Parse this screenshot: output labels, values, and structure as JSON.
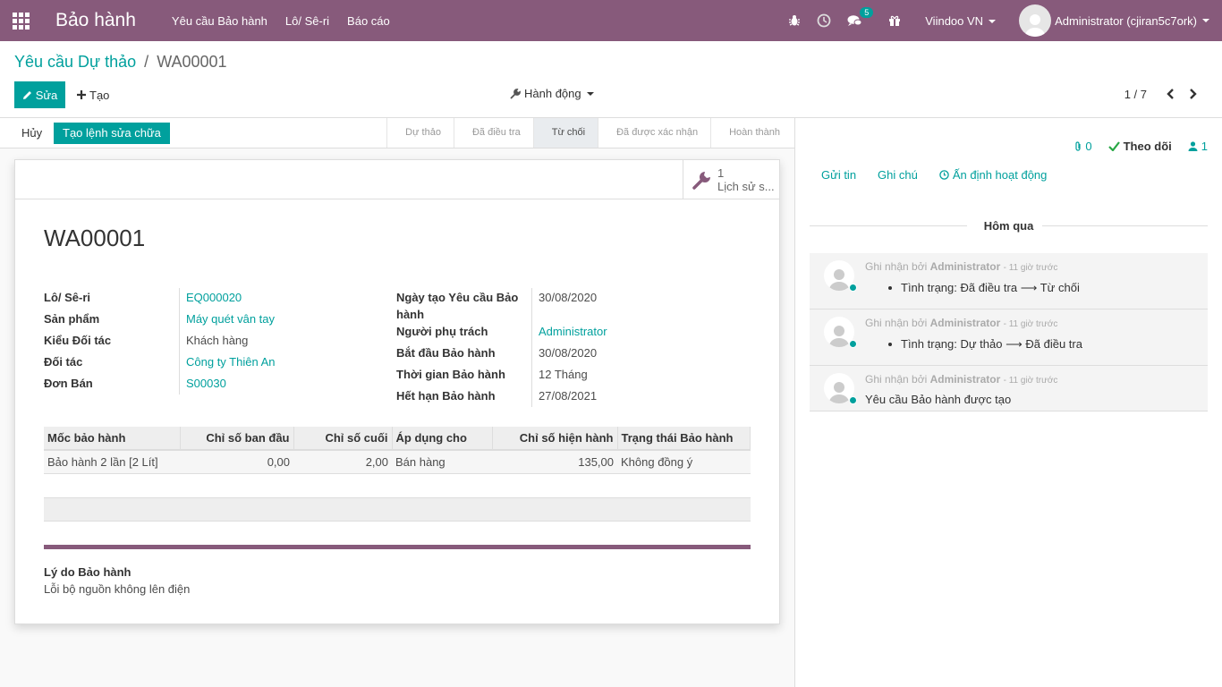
{
  "navbar": {
    "brand": "Bảo hành",
    "menu": [
      "Yêu cầu Bảo hành",
      "Lô/ Sê-ri",
      "Báo cáo"
    ],
    "messages_badge": "5",
    "company": "Viindoo VN",
    "user": "Administrator (cjiran5c7ork)",
    "bg_color": "#875a7b"
  },
  "breadcrumb": {
    "parent": "Yêu cầu Dự thảo",
    "separator": "/",
    "current": "WA00001"
  },
  "toolbar": {
    "edit_label": "Sửa",
    "create_label": "Tạo",
    "action_label": "Hành động",
    "pager": "1 / 7"
  },
  "statusbar": {
    "cancel_label": "Hủy",
    "repair_label": "Tạo lệnh sửa chữa",
    "stages": [
      "Dự thảo",
      "Đã điều tra",
      "Từ chối",
      "Đã được xác nhận",
      "Hoàn thành"
    ],
    "active_stage": "Từ chối"
  },
  "smart_button": {
    "count": "1",
    "label": "Lịch sử s..."
  },
  "record": {
    "title": "WA00001"
  },
  "left_fields": [
    {
      "label": "Lô/ Sê-ri",
      "value": "EQ000020",
      "link": true
    },
    {
      "label": "Sản phẩm",
      "value": "Máy quét vân tay",
      "link": true
    },
    {
      "label": "Kiểu Đối tác",
      "value": "Khách hàng",
      "link": false
    },
    {
      "label": "Đối tác",
      "value": "Công ty Thiên An",
      "link": true
    },
    {
      "label": "Đơn Bán",
      "value": "S00030",
      "link": true
    }
  ],
  "right_fields": {
    "created_label_1": "Ngày tạo Yêu cầu Bảo",
    "created_label_2": "hành",
    "created_value": "30/08/2020",
    "responsible_label": "Người phụ trách",
    "responsible_value": "Administrator",
    "start_label": "Bắt đầu Bảo hành",
    "start_value": "30/08/2020",
    "period_label": "Thời gian Bảo hành",
    "period_value": "12 Tháng",
    "expiry_label": "Hết hạn Bảo hành",
    "expiry_value": "27/08/2021"
  },
  "table": {
    "headers": [
      "Mốc bảo hành",
      "Chỉ số ban đầu",
      "Chỉ số cuối",
      "Áp dụng cho",
      "Chỉ số hiện hành",
      "Trạng thái Bảo hành"
    ],
    "rows": [
      [
        "Bảo hành 2 lần [2 Lít]",
        "0,00",
        "2,00",
        "Bán hàng",
        "135,00",
        "Không đồng ý"
      ]
    ]
  },
  "reason": {
    "label": "Lý do Bảo hành",
    "value": "Lỗi bộ nguồn không lên điện"
  },
  "chatter": {
    "attachments": "0",
    "follow_label": "Theo dõi",
    "followers": "1",
    "send_label": "Gửi tin",
    "note_label": "Ghi chú",
    "activity_label": "Ấn định hoạt động",
    "day_label": "Hôm qua",
    "messages": [
      {
        "prefix": "Ghi nhận bởi",
        "author": "Administrator",
        "time": "- 11 giờ trước",
        "from": "Tình trạng: Đã điều tra",
        "arrow": "⟶",
        "to": "Từ chối"
      },
      {
        "prefix": "Ghi nhận bởi",
        "author": "Administrator",
        "time": "- 11 giờ trước",
        "from": "Tình trạng: Dự thảo",
        "arrow": "⟶",
        "to": "Đã điều tra"
      },
      {
        "prefix": "Ghi nhận bởi",
        "author": "Administrator",
        "time": "- 11 giờ trước",
        "text": "Yêu cầu Bảo hành được tạo"
      }
    ]
  }
}
